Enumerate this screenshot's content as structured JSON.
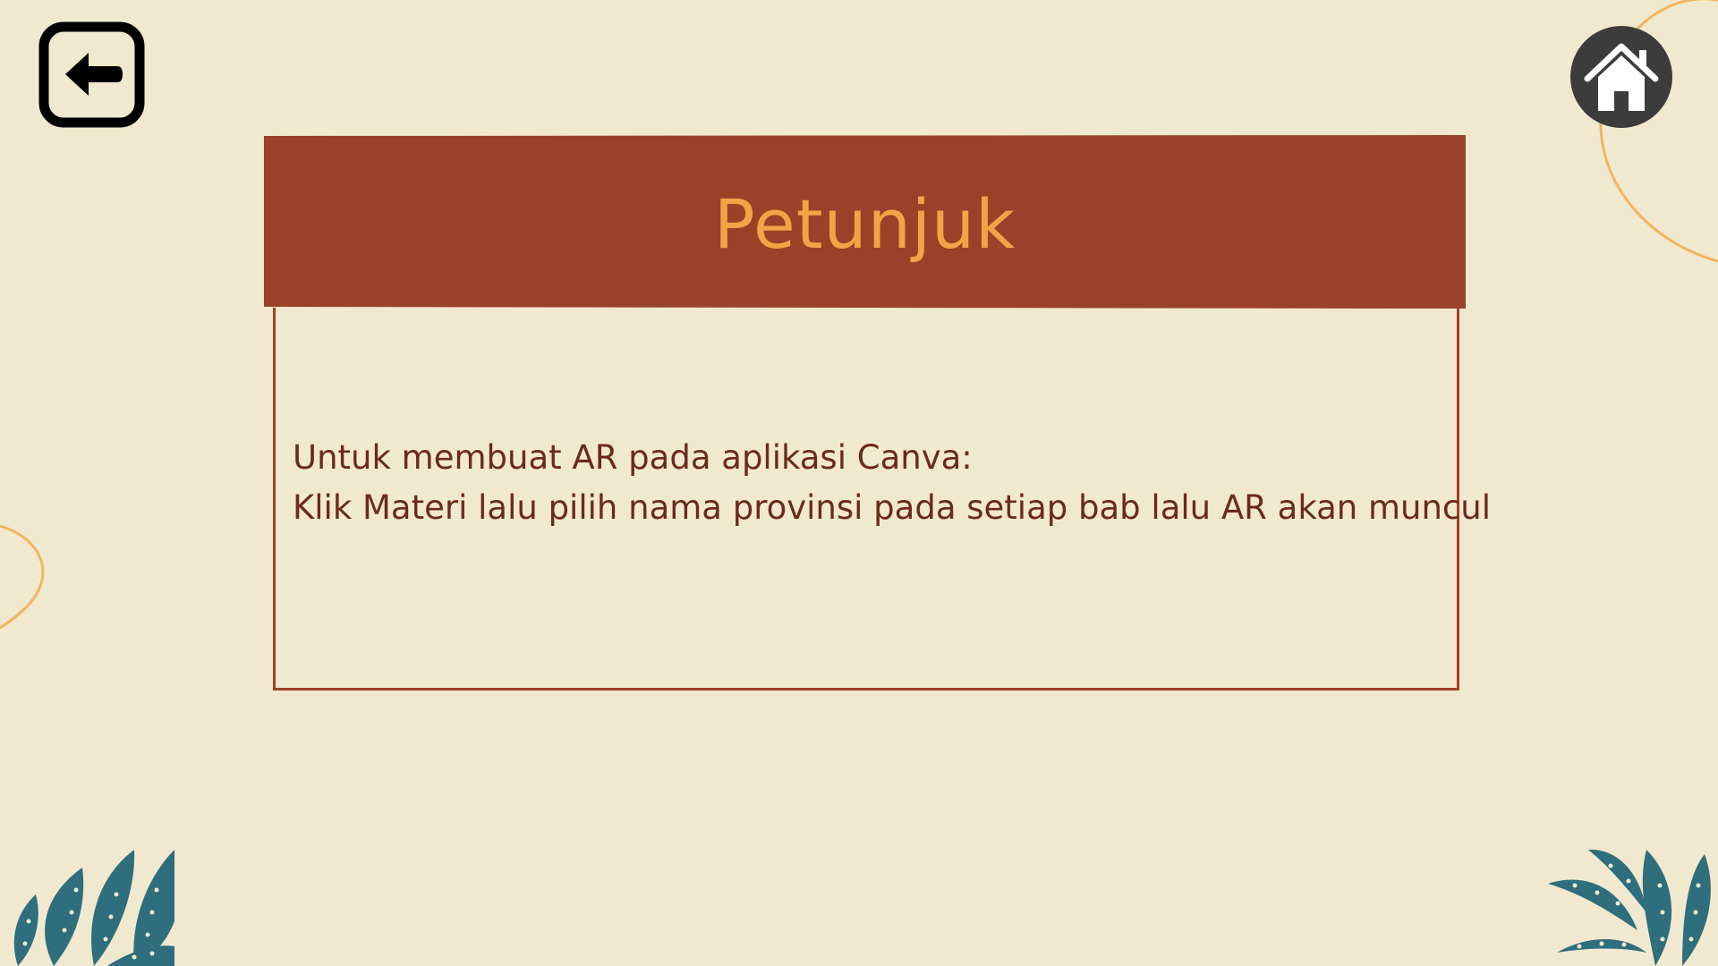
{
  "navigation": {
    "back_icon": "arrow-left-icon",
    "home_icon": "home-icon"
  },
  "panel": {
    "title": "Petunjuk",
    "lines": [
      "Untuk membuat AR pada aplikasi Canva:",
      "Klik Materi lalu pilih nama provinsi pada setiap bab lalu AR akan muncul"
    ]
  },
  "colors": {
    "background": "#f0e9cf",
    "header_band": "#9a412a",
    "title_text": "#f1a445",
    "body_text": "#6b2a1c",
    "leaf": "#2f6e7c",
    "curve": "#f2b45c"
  }
}
